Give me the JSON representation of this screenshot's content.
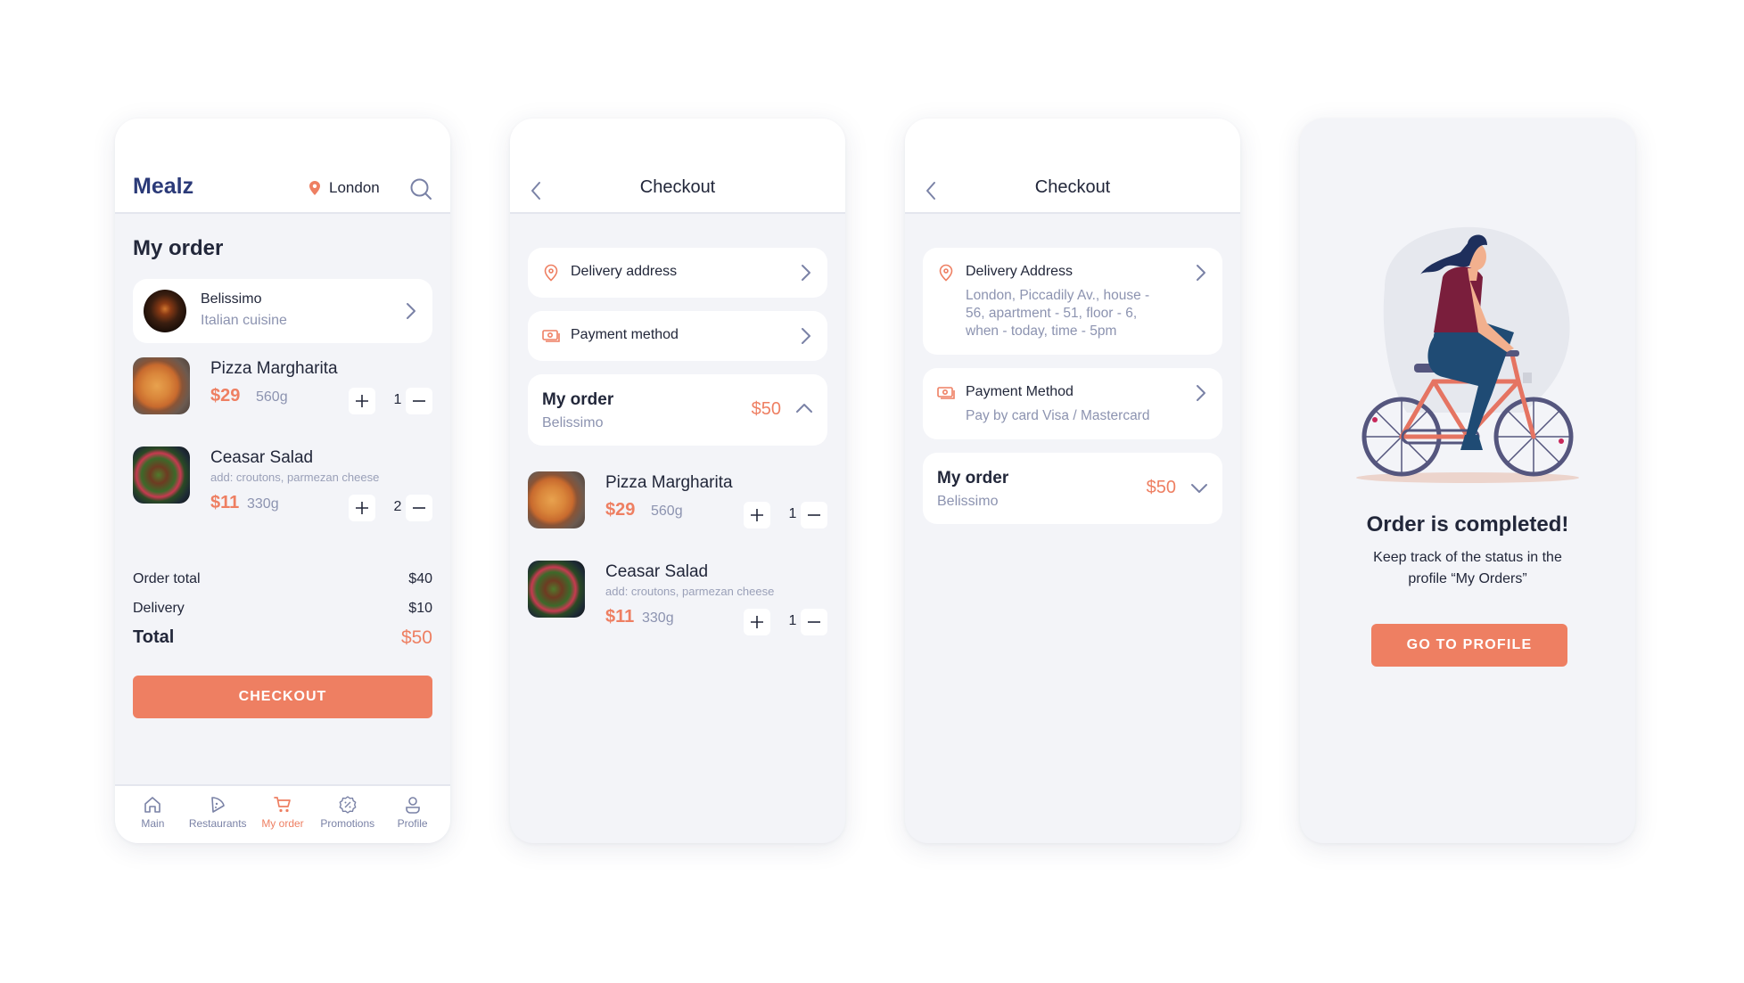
{
  "colors": {
    "accent": "#ee7f62",
    "brand": "#2b3a78",
    "background": "#f3f4f8",
    "muted": "#8c93b0"
  },
  "screen1": {
    "brand": "Mealz",
    "location": "London",
    "location_icon": "map-pin-icon",
    "search_icon": "search-icon",
    "title": "My order",
    "restaurant": {
      "name": "Belissimo",
      "cuisine": "Italian cuisine"
    },
    "items": [
      {
        "name": "Pizza Margharita",
        "addons": "",
        "price": "$29",
        "weight": "560g",
        "qty": "1"
      },
      {
        "name": "Ceasar Salad",
        "addons": "add: croutons, parmezan cheese",
        "price": "$11",
        "weight": "330g",
        "qty": "2"
      }
    ],
    "summary": {
      "order_total_label": "Order total",
      "order_total": "$40",
      "delivery_label": "Delivery",
      "delivery": "$10",
      "total_label": "Total",
      "total": "$50"
    },
    "checkout_button": "CHECKOUT",
    "tabs": [
      {
        "label": "Main",
        "icon": "home-icon",
        "active": false
      },
      {
        "label": "Restaurants",
        "icon": "pizza-slice-icon",
        "active": false
      },
      {
        "label": "My order",
        "icon": "cart-icon",
        "active": true
      },
      {
        "label": "Promotions",
        "icon": "discount-badge-icon",
        "active": false
      },
      {
        "label": "Profile",
        "icon": "user-icon",
        "active": false
      }
    ]
  },
  "screen2": {
    "title": "Checkout",
    "delivery_label": "Delivery address",
    "payment_label": "Payment method",
    "order": {
      "title": "My order",
      "restaurant": "Belissimo",
      "price": "$50",
      "expanded": true
    },
    "items": [
      {
        "name": "Pizza Margharita",
        "addons": "",
        "price": "$29",
        "weight": "560g",
        "qty": "1"
      },
      {
        "name": "Ceasar Salad",
        "addons": "add: croutons, parmezan cheese",
        "price": "$11",
        "weight": "330g",
        "qty": "1"
      }
    ]
  },
  "screen3": {
    "title": "Checkout",
    "delivery_label": "Delivery Address",
    "delivery_lines": [
      "London, Piccadily Av., house -",
      "56, apartment - 51, floor - 6,",
      "when - today, time - 5pm"
    ],
    "payment_label": "Payment Method",
    "payment_sub": "Pay by card Visa / Mastercard",
    "order": {
      "title": "My order",
      "restaurant": "Belissimo",
      "price": "$50",
      "expanded": false
    }
  },
  "screen4": {
    "title": "Order is completed!",
    "subtitle": "Keep track of the status in the profile “My Orders”",
    "button": "GO TO PROFILE",
    "illustration": "woman-riding-bicycle"
  }
}
